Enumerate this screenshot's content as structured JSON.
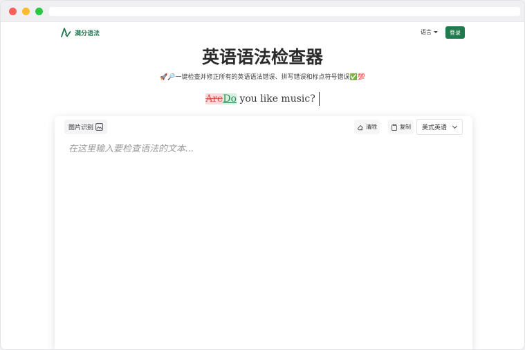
{
  "header": {
    "logo_text": "满分语法",
    "language_label": "语言",
    "login_label": "登录"
  },
  "hero": {
    "title": "英语语法检查器",
    "subtitle": "🚀🔎一键检查并修正所有的英语语法错误、拼写错误和标点符号错误✅💯",
    "demo_wrong": "Are",
    "demo_right": "Do",
    "demo_rest": " you like music?"
  },
  "editor": {
    "image_recognition_label": "图片识别",
    "clear_label": "清除",
    "copy_label": "复制",
    "variant_selected": "美式英语",
    "placeholder": "在这里输入要检查语法的文本..."
  },
  "colors": {
    "brand": "#1f7a4d",
    "error": "#d9534f",
    "correct": "#2d8a57"
  }
}
